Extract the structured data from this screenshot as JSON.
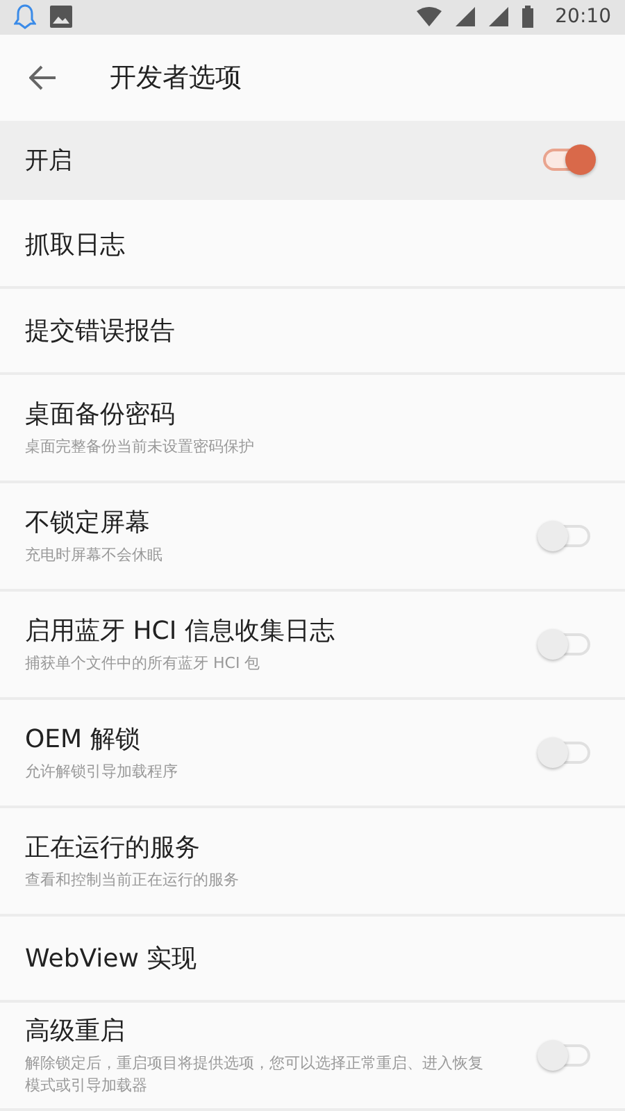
{
  "status_bar": {
    "time": "20:10"
  },
  "toolbar": {
    "title": "开发者选项"
  },
  "master": {
    "label": "开启",
    "on": true
  },
  "items": [
    {
      "kind": "plain",
      "title": "抓取日志"
    },
    {
      "kind": "plain",
      "title": "提交错误报告"
    },
    {
      "kind": "plain",
      "title": "桌面备份密码",
      "summary": "桌面完整备份当前未设置密码保护"
    },
    {
      "kind": "switch",
      "title": "不锁定屏幕",
      "summary": "充电时屏幕不会休眠",
      "on": false
    },
    {
      "kind": "switch",
      "title": "启用蓝牙 HCI 信息收集日志",
      "summary": "捕获单个文件中的所有蓝牙 HCI 包",
      "on": false
    },
    {
      "kind": "switch",
      "title": "OEM 解锁",
      "summary": "允许解锁引导加载程序",
      "on": false
    },
    {
      "kind": "plain",
      "title": "正在运行的服务",
      "summary": "查看和控制当前正在运行的服务"
    },
    {
      "kind": "plain",
      "title": "WebView 实现"
    },
    {
      "kind": "switch",
      "title": "高级重启",
      "summary": "解除锁定后，重启项目将提供选项，您可以选择正常重启、进入恢复模式或引导加载器",
      "on": false
    }
  ]
}
